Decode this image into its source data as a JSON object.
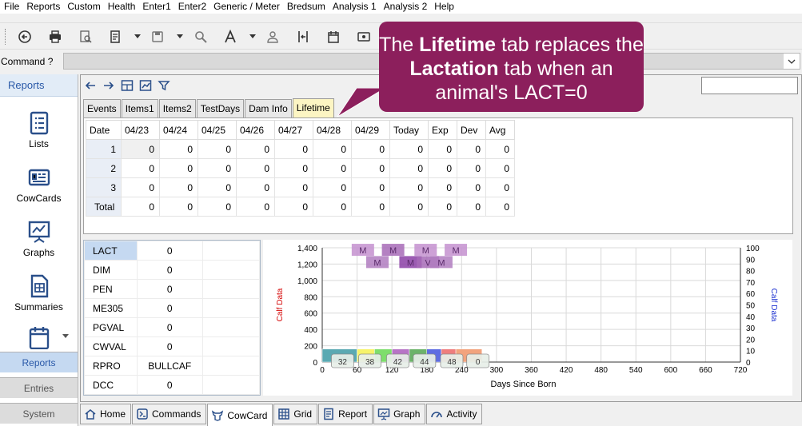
{
  "menu": [
    "File",
    "Reports",
    "Custom",
    "Health",
    "Enter1",
    "Enter2",
    "Generic / Meter",
    "Bredsum",
    "Analysis 1",
    "Analysis 2",
    "Help"
  ],
  "toolbar": {
    "icons": [
      "back-circle-icon",
      "printer-icon",
      "print-preview-icon",
      "report-book-icon",
      "save-icon",
      "magnifier-icon",
      "font-icon",
      "person-icon",
      "column-resize-icon",
      "calendar-icon",
      "card-icon"
    ]
  },
  "command": {
    "label": "Command ?",
    "value": ""
  },
  "sidebar": {
    "header": "Reports",
    "tools": [
      {
        "label": "Lists",
        "icon": "list-doc-icon"
      },
      {
        "label": "CowCards",
        "icon": "cowcard-icon"
      },
      {
        "label": "Graphs",
        "icon": "graph-board-icon"
      },
      {
        "label": "Summaries",
        "icon": "summary-doc-icon"
      },
      {
        "label": "",
        "icon": "calendar-check-icon"
      }
    ],
    "panels": [
      "Reports",
      "Entries",
      "System"
    ],
    "active_panel": "Reports"
  },
  "tabs": [
    "Events",
    "Items1",
    "Items2",
    "TestDays",
    "Dam Info",
    "Lifetime"
  ],
  "active_tab": "Lifetime",
  "grid": {
    "headers": [
      "Date",
      "04/23",
      "04/24",
      "04/25",
      "04/26",
      "04/27",
      "04/28",
      "04/29",
      "Today",
      "Exp",
      "Dev",
      "Avg"
    ],
    "rows": [
      {
        "label": "1",
        "cells": [
          "0",
          "0",
          "0",
          "0",
          "0",
          "0",
          "0",
          "0",
          "0",
          "0",
          "0"
        ]
      },
      {
        "label": "2",
        "cells": [
          "0",
          "0",
          "0",
          "0",
          "0",
          "0",
          "0",
          "0",
          "0",
          "0",
          "0"
        ]
      },
      {
        "label": "3",
        "cells": [
          "0",
          "0",
          "0",
          "0",
          "0",
          "0",
          "0",
          "0",
          "0",
          "0",
          "0"
        ]
      },
      {
        "label": "Total",
        "cells": [
          "0",
          "0",
          "0",
          "0",
          "0",
          "0",
          "0",
          "0",
          "0",
          "0",
          "0"
        ]
      }
    ]
  },
  "kv": [
    {
      "key": "LACT",
      "value": "0"
    },
    {
      "key": "DIM",
      "value": "0"
    },
    {
      "key": "PEN",
      "value": "0"
    },
    {
      "key": "ME305",
      "value": "0"
    },
    {
      "key": "PGVAL",
      "value": "0"
    },
    {
      "key": "CWVAL",
      "value": "0"
    },
    {
      "key": "RPRO",
      "value": "BULLCAF"
    },
    {
      "key": "DCC",
      "value": "0"
    }
  ],
  "chart_data": {
    "type": "bar",
    "xlabel": "Days Since Born",
    "ylabel_left": "Calf Data",
    "ylabel_right": "Calf Data",
    "xlim": [
      0,
      720
    ],
    "x_ticks": [
      0,
      60,
      120,
      180,
      240,
      300,
      360,
      420,
      480,
      540,
      600,
      660,
      720
    ],
    "ylim_left": [
      0,
      1400
    ],
    "y_ticks_left": [
      0,
      200,
      400,
      600,
      800,
      1000,
      1200,
      1400
    ],
    "ylim_right": [
      0,
      100
    ],
    "y_ticks_right": [
      0,
      10,
      20,
      30,
      40,
      50,
      60,
      70,
      80,
      90,
      100
    ],
    "grid": true,
    "bars": [
      {
        "x0": 0,
        "x1": 60,
        "value": 160,
        "color": "#5aa9b2"
      },
      {
        "x0": 60,
        "x1": 90,
        "value": 160,
        "color": "#f6f36a"
      },
      {
        "x0": 90,
        "x1": 120,
        "value": 160,
        "color": "#7ede6c"
      },
      {
        "x0": 120,
        "x1": 150,
        "value": 160,
        "color": "#b774c6"
      },
      {
        "x0": 150,
        "x1": 180,
        "value": 160,
        "color": "#6cb36a"
      },
      {
        "x0": 180,
        "x1": 205,
        "value": 160,
        "color": "#5e6ce2"
      },
      {
        "x0": 205,
        "x1": 230,
        "value": 160,
        "color": "#ef7d7d"
      },
      {
        "x0": 230,
        "x1": 275,
        "value": 160,
        "color": "#f2a37d"
      }
    ],
    "bar_labels": [
      {
        "x": 35,
        "text": "32"
      },
      {
        "x": 82,
        "text": "38"
      },
      {
        "x": 130,
        "text": "42"
      },
      {
        "x": 176,
        "text": "44"
      },
      {
        "x": 223,
        "text": "48"
      },
      {
        "x": 268,
        "text": "0"
      }
    ],
    "markers_top": [
      {
        "x": 70,
        "value": 1370,
        "text": "M",
        "color": "#c490cf"
      },
      {
        "x": 122,
        "value": 1370,
        "text": "M",
        "color": "#a76bb7"
      },
      {
        "x": 178,
        "value": 1370,
        "text": "M",
        "color": "#c490cf"
      },
      {
        "x": 230,
        "value": 1370,
        "text": "M",
        "color": "#c490cf"
      }
    ],
    "markers_bottom": [
      {
        "x": 95,
        "value": 1220,
        "text": "M",
        "color": "#b07cc0"
      },
      {
        "x": 152,
        "value": 1220,
        "text": "M",
        "color": "#8b3fa6"
      },
      {
        "x": 182,
        "value": 1220,
        "text": "V",
        "color": "#a76bb7"
      },
      {
        "x": 205,
        "value": 1220,
        "text": "M",
        "color": "#b07cc0"
      }
    ]
  },
  "bottom_tabs": [
    {
      "label": "Home",
      "icon": "home-icon"
    },
    {
      "label": "Commands",
      "icon": "commands-icon"
    },
    {
      "label": "CowCard",
      "icon": "cow-icon"
    },
    {
      "label": "Grid",
      "icon": "grid-icon"
    },
    {
      "label": "Report",
      "icon": "report-icon"
    },
    {
      "label": "Graph",
      "icon": "graph-icon"
    },
    {
      "label": "Activity",
      "icon": "activity-gauge-icon"
    }
  ],
  "active_bottom_tab": "CowCard",
  "callout": {
    "pre": "The ",
    "b1": "Lifetime",
    "mid1": " tab replaces the ",
    "b2": "Lactation",
    "post": " tab when an animal's LACT=0",
    "color": "#8c1f5c"
  }
}
